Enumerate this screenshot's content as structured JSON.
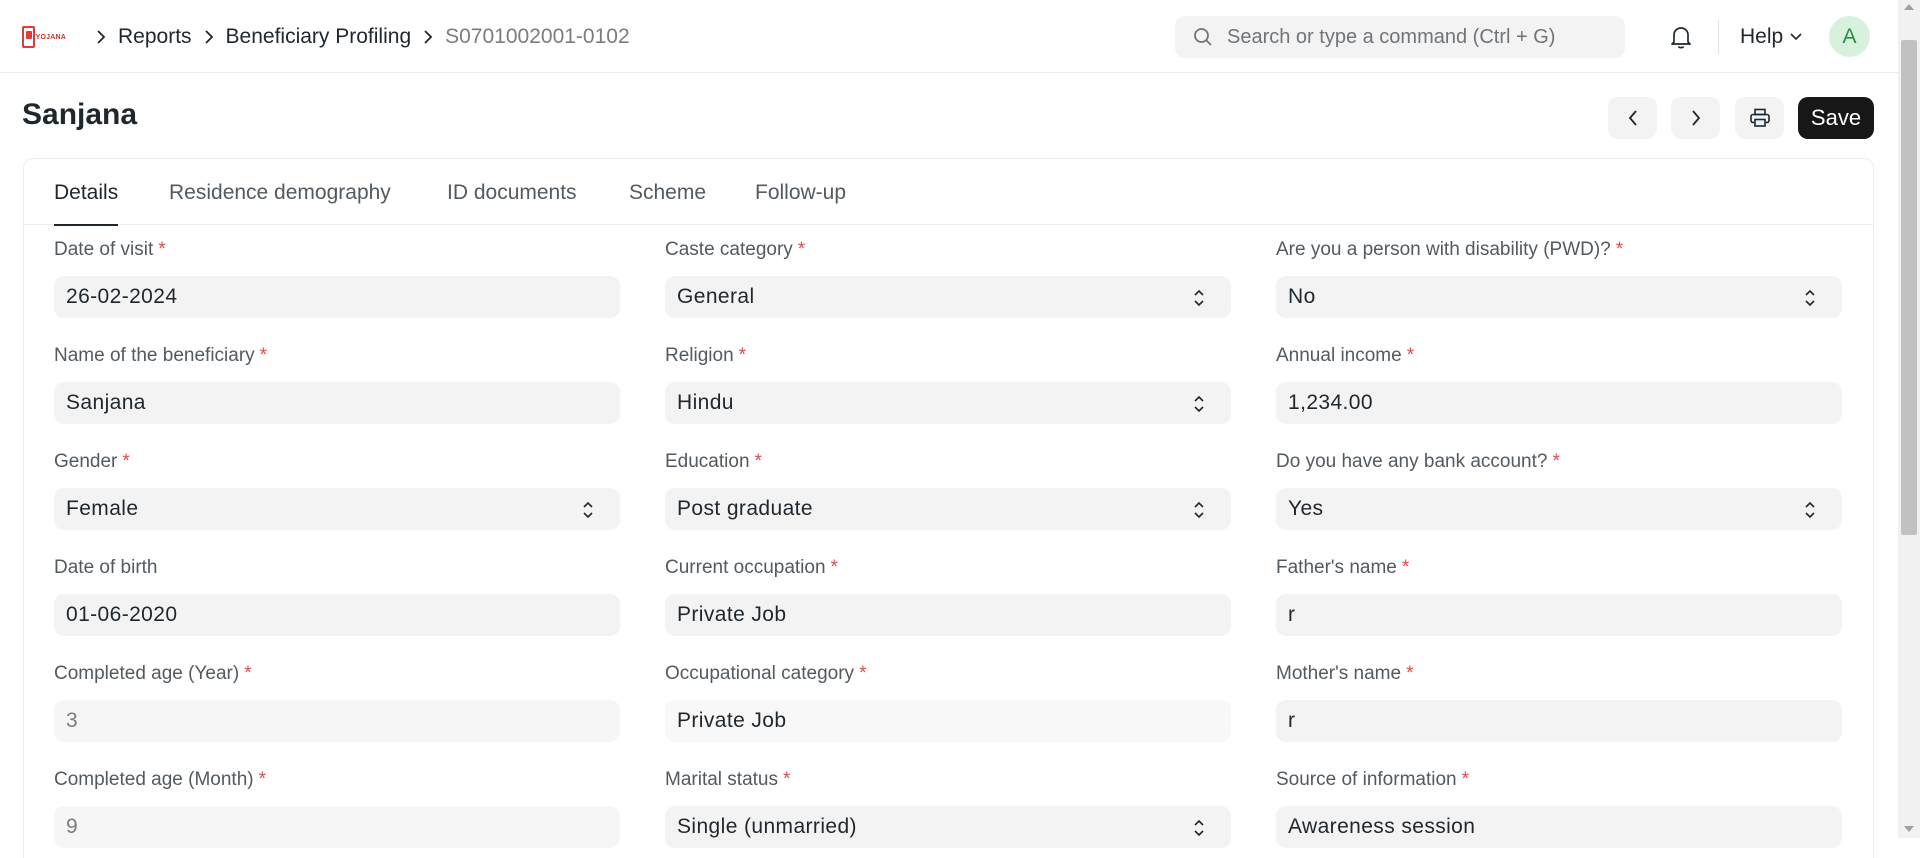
{
  "logo": {
    "word": "YOJANA"
  },
  "breadcrumbs": [
    "Reports",
    "Beneficiary Profiling",
    "S0701002001-0102"
  ],
  "search": {
    "placeholder": "Search or type a command (Ctrl + G)"
  },
  "navbar": {
    "help_label": "Help",
    "avatar_initial": "A"
  },
  "page": {
    "title": "Sanjana",
    "save_label": "Save"
  },
  "tabs": [
    "Details",
    "Residence demography",
    "ID documents",
    "Scheme",
    "Follow-up"
  ],
  "fields": [
    {
      "label": "Date of visit",
      "value": "26-02-2024",
      "required": "*"
    },
    {
      "label": "Caste category",
      "value": "General",
      "required": "*"
    },
    {
      "label": "Are you a person with disability (PWD)?",
      "value": "No",
      "required": "*"
    },
    {
      "label": "Name of the beneficiary",
      "value": "Sanjana",
      "required": "*"
    },
    {
      "label": "Religion",
      "value": "Hindu",
      "required": "*"
    },
    {
      "label": "Annual income",
      "value": "1,234.00",
      "required": "*"
    },
    {
      "label": "Gender",
      "value": "Female",
      "required": "*"
    },
    {
      "label": "Education",
      "value": "Post graduate",
      "required": "*"
    },
    {
      "label": "Do you have any bank account?",
      "value": "Yes",
      "required": "*"
    },
    {
      "label": "Date of birth",
      "value": "01-06-2020",
      "required": ""
    },
    {
      "label": "Current occupation",
      "value": "Private Job",
      "required": "*"
    },
    {
      "label": "Father's name",
      "value": "r",
      "required": "*"
    },
    {
      "label": "Completed age (Year)",
      "value": "3",
      "required": "*"
    },
    {
      "label": "Occupational category",
      "value": "Private Job",
      "required": "*"
    },
    {
      "label": "Mother's name",
      "value": "r",
      "required": "*"
    },
    {
      "label": "Completed age (Month)",
      "value": "9",
      "required": "*"
    },
    {
      "label": "Marital status",
      "value": "Single (unmarried)",
      "required": "*"
    },
    {
      "label": "Source of information",
      "value": "Awareness session",
      "required": "*"
    }
  ],
  "colors": {
    "accent": "#171717",
    "required": "#e24c4c",
    "field_bg": "#f3f3f3"
  }
}
